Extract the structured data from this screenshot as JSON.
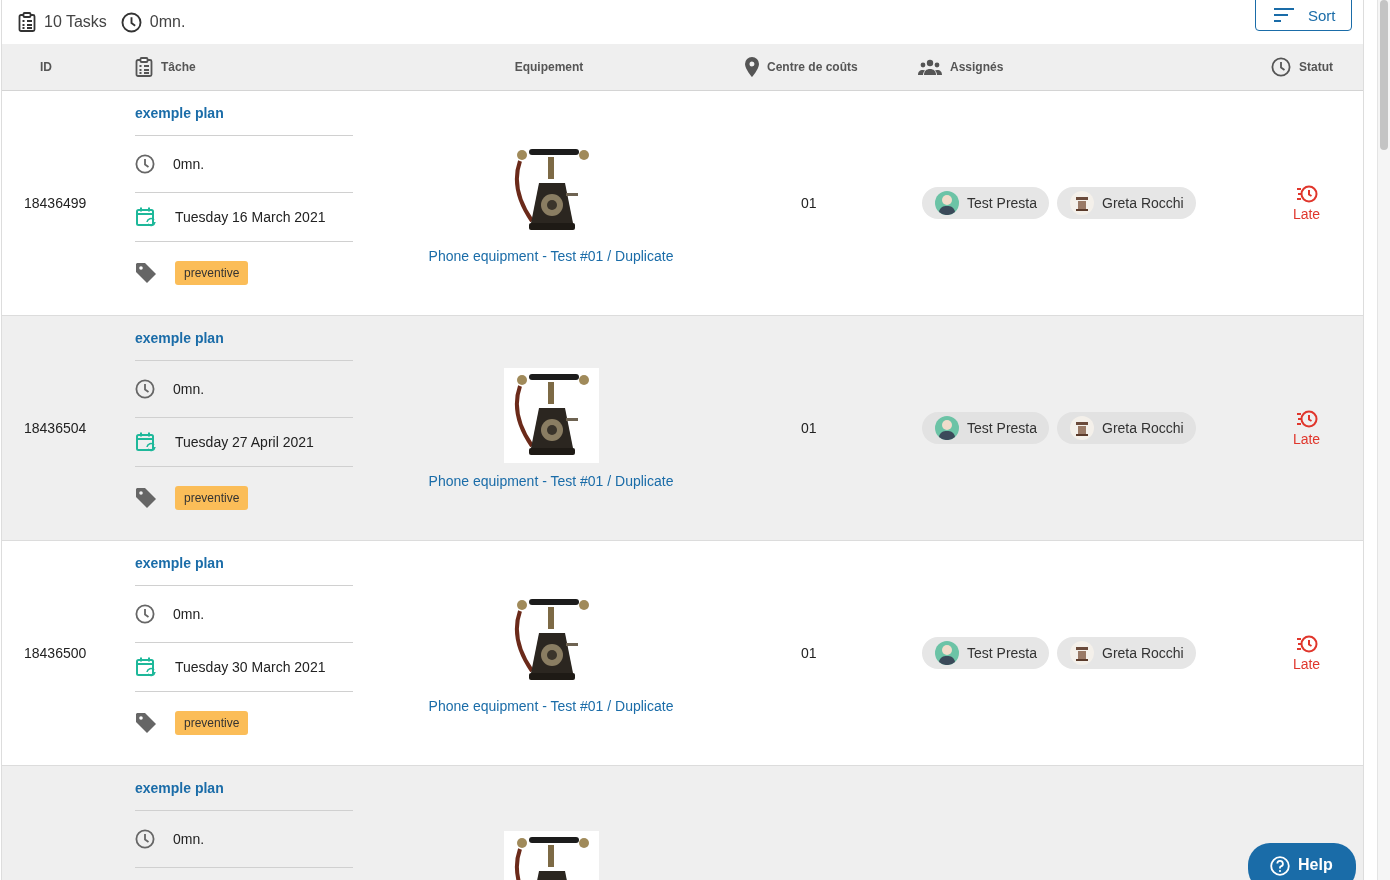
{
  "summary": {
    "tasks": "10 Tasks",
    "duration": "0mn."
  },
  "sort_button": {
    "label": "Sort"
  },
  "table": {
    "columns": [
      {
        "label": "ID"
      },
      {
        "label": "Tâche"
      },
      {
        "label": "Equipement"
      },
      {
        "label": "Centre de coûts"
      },
      {
        "label": "Assignés"
      },
      {
        "label": "Statut"
      }
    ],
    "rows": [
      {
        "id": "18436499",
        "title": "exemple plan",
        "duration": "0mn.",
        "date": "Tuesday 16 March 2021",
        "tag": "preventive",
        "equipment": {
          "label": "Phone equipment - Test #01 / Duplicate"
        },
        "cost_center": "01",
        "assignees": [
          {
            "name": "Test Presta"
          },
          {
            "name": "Greta Rocchi"
          }
        ],
        "status": {
          "label": "Late",
          "kind": "late"
        }
      },
      {
        "id": "18436504",
        "title": "exemple plan",
        "duration": "0mn.",
        "date": "Tuesday 27 April 2021",
        "tag": "preventive",
        "equipment": {
          "label": "Phone equipment - Test #01 / Duplicate"
        },
        "cost_center": "01",
        "assignees": [
          {
            "name": "Test Presta"
          },
          {
            "name": "Greta Rocchi"
          }
        ],
        "status": {
          "label": "Late",
          "kind": "late"
        }
      },
      {
        "id": "18436500",
        "title": "exemple plan",
        "duration": "0mn.",
        "date": "Tuesday 30 March 2021",
        "tag": "preventive",
        "equipment": {
          "label": "Phone equipment - Test #01 / Duplicate"
        },
        "cost_center": "01",
        "assignees": [
          {
            "name": "Test Presta"
          },
          {
            "name": "Greta Rocchi"
          }
        ],
        "status": {
          "label": "Late",
          "kind": "late"
        }
      },
      {
        "title": "exemple plan",
        "duration": "0mn."
      }
    ]
  },
  "help_button": {
    "label": "Help"
  }
}
